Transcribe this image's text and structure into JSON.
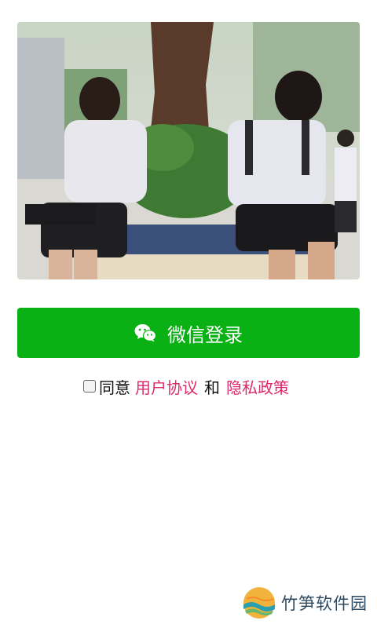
{
  "hero": {
    "image_name": "students-under-tree-photo"
  },
  "login": {
    "label": "微信登录",
    "icon": "wechat-icon",
    "color": "#0ab114"
  },
  "agreement": {
    "checked": false,
    "prefix": "同意",
    "user_agreement": "用户协议",
    "and": "和",
    "privacy_policy": "隐私政策",
    "link_color": "#e0286a"
  },
  "watermark": {
    "text": "竹笋软件园",
    "icon": "zhusun-logo-icon"
  }
}
